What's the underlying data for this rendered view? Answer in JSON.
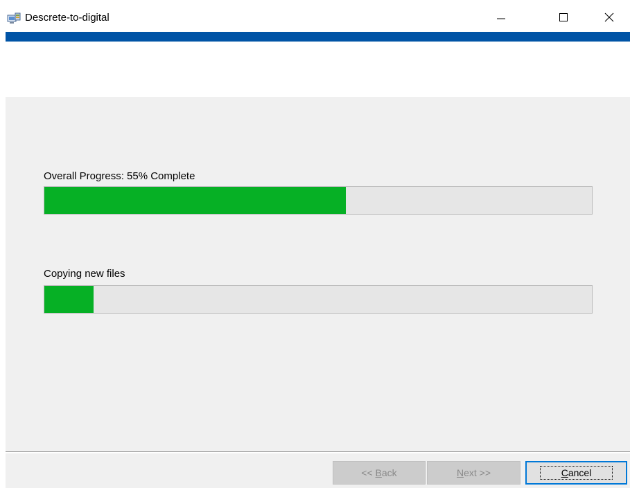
{
  "window": {
    "title": "Descrete-to-digital",
    "icon": "installer-computer-icon",
    "controls": {
      "minimize_icon": "minimize-icon",
      "maximize_icon": "maximize-icon",
      "close_icon": "close-icon"
    }
  },
  "colors": {
    "accent": "#0054a6",
    "progress_fill": "#06b025"
  },
  "progress": {
    "overall": {
      "label": "Overall Progress: 55% Complete",
      "percent": 55
    },
    "current": {
      "label": "Copying new files",
      "percent": 9
    }
  },
  "buttons": {
    "back": {
      "label": "<< Back",
      "mnemonic": "B",
      "enabled": false
    },
    "next": {
      "label": "Next >>",
      "mnemonic": "N",
      "enabled": false
    },
    "cancel": {
      "label": "Cancel",
      "mnemonic": "C",
      "enabled": true,
      "focused": true
    }
  }
}
